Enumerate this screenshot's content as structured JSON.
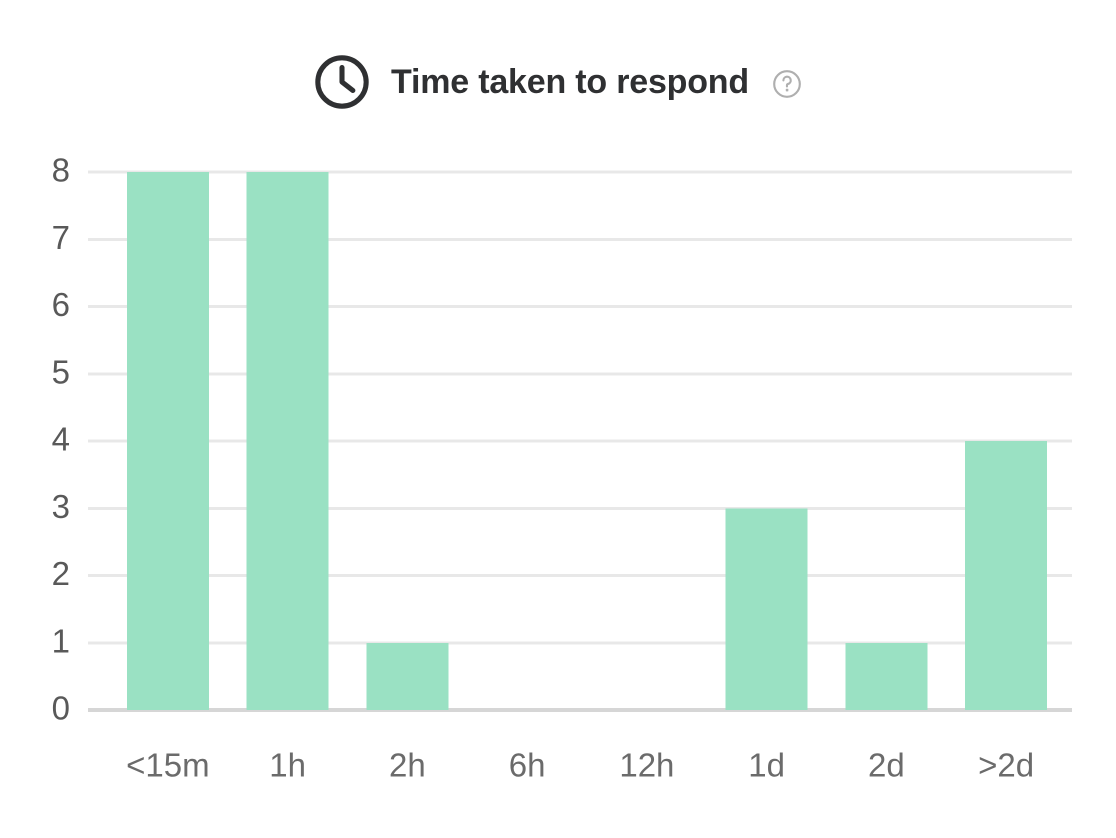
{
  "header": {
    "title": "Time taken to respond",
    "clock_icon": "clock-icon",
    "help_icon": "help-circle-icon"
  },
  "colors": {
    "bar": "#9AE1C3",
    "gridline": "#E8E8E8",
    "axis": "#D6D6D6",
    "title_text": "#2F3032",
    "tick_text": "#595959",
    "help_icon": "#AFAFAF",
    "background": "#FFFFFF"
  },
  "chart_data": {
    "type": "bar",
    "title": "Time taken to respond",
    "xlabel": "",
    "ylabel": "",
    "categories": [
      "<15m",
      "1h",
      "2h",
      "6h",
      "12h",
      "1d",
      "2d",
      ">2d"
    ],
    "values": [
      8,
      8,
      1,
      0,
      0,
      3,
      1,
      4
    ],
    "ylim": [
      0,
      8
    ],
    "yticks": [
      0,
      1,
      2,
      3,
      4,
      5,
      6,
      7,
      8
    ],
    "ytick_labels": [
      "0",
      "1",
      "2",
      "3",
      "4",
      "5",
      "6",
      "7",
      "8"
    ],
    "grid": true,
    "legend": false,
    "legend_position": "none",
    "bar_color": "#9AE1C3"
  }
}
